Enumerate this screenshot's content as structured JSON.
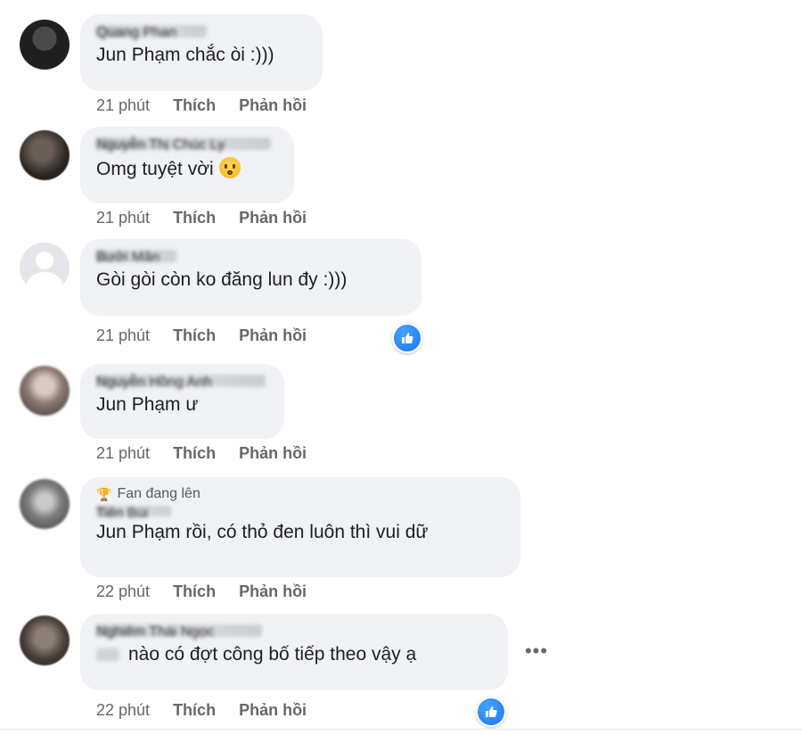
{
  "comments": [
    {
      "name": "Quang Phan",
      "text": "Jun Phạm chắc òi :)))",
      "time": "21 phút",
      "like_label": "Thích",
      "reply_label": "Phản hồi"
    },
    {
      "name": "Nguyễn Thị Chúc Ly",
      "text": "Omg tuyệt vời",
      "time": "21 phút",
      "like_label": "Thích",
      "reply_label": "Phản hồi"
    },
    {
      "name": "Bưởi Măn",
      "text": "Gòi gòi còn ko đăng lun đy :)))",
      "time": "21 phút",
      "like_label": "Thích",
      "reply_label": "Phản hồi",
      "reaction_icon": "like-icon"
    },
    {
      "name": "Nguyễn Hồng Anh",
      "text": "Jun Phạm ư",
      "time": "21 phút",
      "like_label": "Thích",
      "reply_label": "Phản hồi"
    },
    {
      "badge": "Fan đang lên",
      "name": "Tiên Bùi",
      "text": "Jun Phạm rồi, có thỏ đen luôn thì vui dữ",
      "time": "22 phút",
      "like_label": "Thích",
      "reply_label": "Phản hồi"
    },
    {
      "name": "Nghiêm Thái Ngọc",
      "text": "nào có đợt công bố tiếp theo vậy ạ",
      "time": "22 phút",
      "like_label": "Thích",
      "reply_label": "Phản hồi",
      "reaction_icon": "like-icon",
      "more_label": "•••"
    }
  ],
  "colors": {
    "bubble": "#f0f2f5",
    "meta_text": "#65676b",
    "like_blue": "#1877f2"
  }
}
